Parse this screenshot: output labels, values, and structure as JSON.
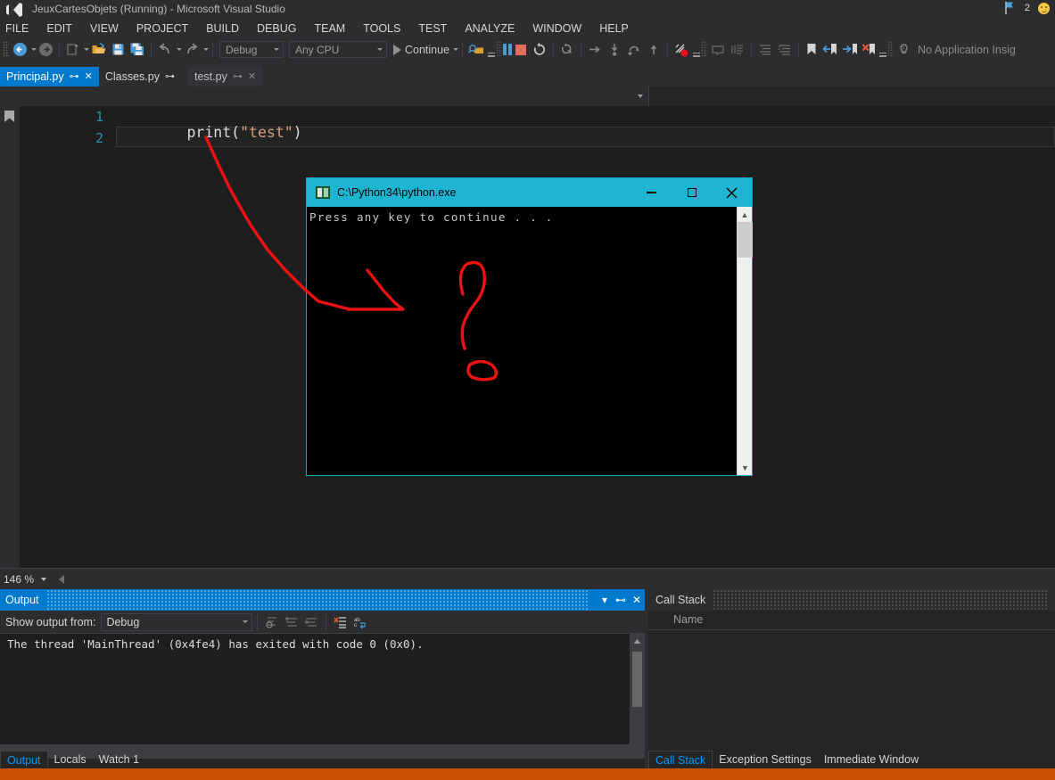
{
  "window": {
    "title": "JeuxCartesObjets (Running) - Microsoft Visual Studio",
    "logo_icon": "visual-studio-logo-icon",
    "notification_count": "2",
    "flag_icon": "feedback-flag-icon",
    "smiley_icon": "send-a-smile-icon"
  },
  "menubar": {
    "items": [
      {
        "label": "FILE"
      },
      {
        "label": "EDIT"
      },
      {
        "label": "VIEW"
      },
      {
        "label": "PROJECT"
      },
      {
        "label": "BUILD"
      },
      {
        "label": "DEBUG"
      },
      {
        "label": "TEAM"
      },
      {
        "label": "TOOLS"
      },
      {
        "label": "TEST"
      },
      {
        "label": "ANALYZE"
      },
      {
        "label": "WINDOW"
      },
      {
        "label": "HELP"
      }
    ]
  },
  "toolbar": {
    "navigate_back_icon": "navigate-back-icon",
    "navigate_forward_icon": "navigate-forward-icon",
    "new_project_icon": "new-project-icon",
    "open_file_icon": "open-file-icon",
    "save_icon": "save-icon",
    "save_all_icon": "save-all-icon",
    "undo_icon": "undo-icon",
    "redo_icon": "redo-icon",
    "configuration": "Debug",
    "platform": "Any CPU",
    "continue_label": "Continue",
    "play_icon": "play-icon",
    "attach_icon": "attach-to-process-icon",
    "pause_icon": "break-all-icon",
    "stop_icon": "stop-debugging-icon",
    "restart_icon": "restart-icon",
    "show_next_statement_icon": "show-next-statement-icon",
    "step_into_icon": "step-into-icon",
    "step_over_icon": "step-over-icon",
    "step_out_icon": "step-out-icon",
    "breakpoints_icon": "breakpoints-icon",
    "comment_icon": "comment-selection-icon",
    "uncomment_icon": "uncomment-selection-icon",
    "indent_icon": "decrease-indent-icon",
    "outdent_icon": "increase-indent-icon",
    "toggle_bookmark_icon": "toggle-bookmark-icon",
    "prev_bookmark_icon": "previous-bookmark-icon",
    "next_bookmark_icon": "next-bookmark-icon",
    "clear_bookmarks_icon": "clear-bookmarks-icon",
    "app_insights_label": "No Application Insig"
  },
  "tabs": [
    {
      "label": "Principal.py",
      "state": "active",
      "pin_icon": "pin-icon",
      "close_icon": "close-icon",
      "has_close": true
    },
    {
      "label": "Classes.py",
      "state": "inactive",
      "pin_icon": "pin-icon",
      "has_close": false
    },
    {
      "label": "test.py",
      "state": "dim",
      "pin_icon": "pin-icon",
      "close_icon": "close-icon",
      "has_close": true
    }
  ],
  "editor": {
    "bookmark_icon": "bookmark-glyph-icon",
    "lines": [
      {
        "number": "1",
        "prefix": "print(",
        "string": "\"test\"",
        "suffix": ")"
      },
      {
        "number": "2",
        "prefix": "",
        "string": "",
        "suffix": ""
      }
    ],
    "zoom_level": "146 %"
  },
  "console": {
    "title": "C:\\Python34\\python.exe",
    "app_icon": "console-app-icon",
    "minimize_icon": "minimize-icon",
    "maximize_icon": "maximize-icon",
    "close_icon": "close-icon",
    "output_text": "Press any key to continue . . .",
    "scroll_up_icon": "scroll-up-icon",
    "scroll_down_icon": "scroll-down-icon"
  },
  "annotation": {
    "arrow_color": "#ee1111",
    "question_mark_color": "#ee1111"
  },
  "output_panel": {
    "title": "Output",
    "dropdown_icon": "chevron-down-icon",
    "pin_icon": "pin-icon",
    "close_icon": "close-icon",
    "filter_label": "Show output from:",
    "filter_value": "Debug",
    "find_message_icon": "find-message-icon",
    "go_prev_icon": "go-to-previous-message-icon",
    "go_next_icon": "go-to-next-message-icon",
    "clear_all_icon": "clear-all-icon",
    "toggle_wordwrap_icon": "toggle-word-wrap-icon",
    "lines": [
      "The thread 'MainThread' (0x4fe4) has exited with code 0 (0x0)."
    ]
  },
  "callstack_panel": {
    "title": "Call Stack",
    "column_name": "Name",
    "rows": []
  },
  "bottom_left_tabs": [
    {
      "label": "Output",
      "state": "active"
    },
    {
      "label": "Locals",
      "state": "idle"
    },
    {
      "label": "Watch 1",
      "state": "idle"
    }
  ],
  "bottom_right_tabs": [
    {
      "label": "Call Stack",
      "state": "active"
    },
    {
      "label": "Exception Settings",
      "state": "idle"
    },
    {
      "label": "Immediate Window",
      "state": "idle"
    }
  ],
  "statusbar": {
    "color": "#ca5100"
  }
}
